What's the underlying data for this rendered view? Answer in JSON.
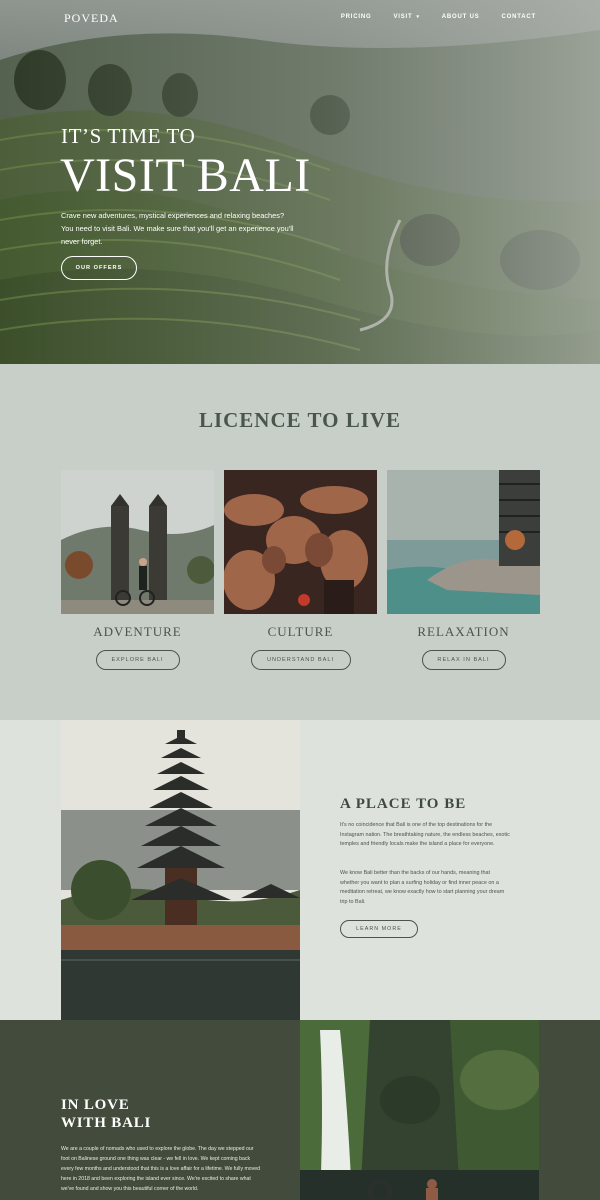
{
  "nav": {
    "logo": "POVEDA",
    "links": [
      {
        "label": "PRICING"
      },
      {
        "label": "VISIT"
      },
      {
        "label": "ABOUT US"
      },
      {
        "label": "CONTACT"
      }
    ],
    "visit_caret": "▾"
  },
  "hero": {
    "pre_title": "IT’S TIME TO",
    "title": "VISIT BALI",
    "text": "Crave new adventures, mystical experiences and relaxing beaches? You need to visit Bali. We make sure that you'll get an experience you'll never forget.",
    "button": "OUR OFFERS"
  },
  "licence": {
    "title": "LICENCE TO LIVE",
    "cards": [
      {
        "label": "ADVENTURE",
        "button": "EXPLORE BALI"
      },
      {
        "label": "CULTURE",
        "button": "UNDERSTAND BALI"
      },
      {
        "label": "RELAXATION",
        "button": "RELAX IN BALI"
      }
    ]
  },
  "place": {
    "title": "A PLACE TO BE",
    "p1": "It's no coincidence that Bali is one of the top destinations for the Instagram nation. The breathtaking nature, the endless beaches, exotic temples and friendly locals make the island a place for everyone.",
    "p2": "We know Bali better than the backs of our hands, meaning that whether you want to plan a surfing holiday or find inner peace on a meditation retreat, we know exactly how to start planning your dream trip to Bali.",
    "button": "LEARN MORE"
  },
  "love": {
    "title_line1": "IN LOVE",
    "title_line2": "WITH BALI",
    "text": "We are a couple of nomads who used to explore the globe. The day we stepped our foot on Balinese ground one thing was clear - we fell in love. We kept coming back every few months and understood that this is a love affair for a lifetime. We fully moved here in 2018 and been exploring the island ever since. We're excited to share what we've found and show you this beautiful corner of the world."
  },
  "colors": {
    "hero_text": "#ffffff",
    "licence_bg": "#c8cfc9",
    "place_bg": "#dde2dd",
    "love_bg": "#434c3c",
    "heading_dark": "#4a564a"
  }
}
